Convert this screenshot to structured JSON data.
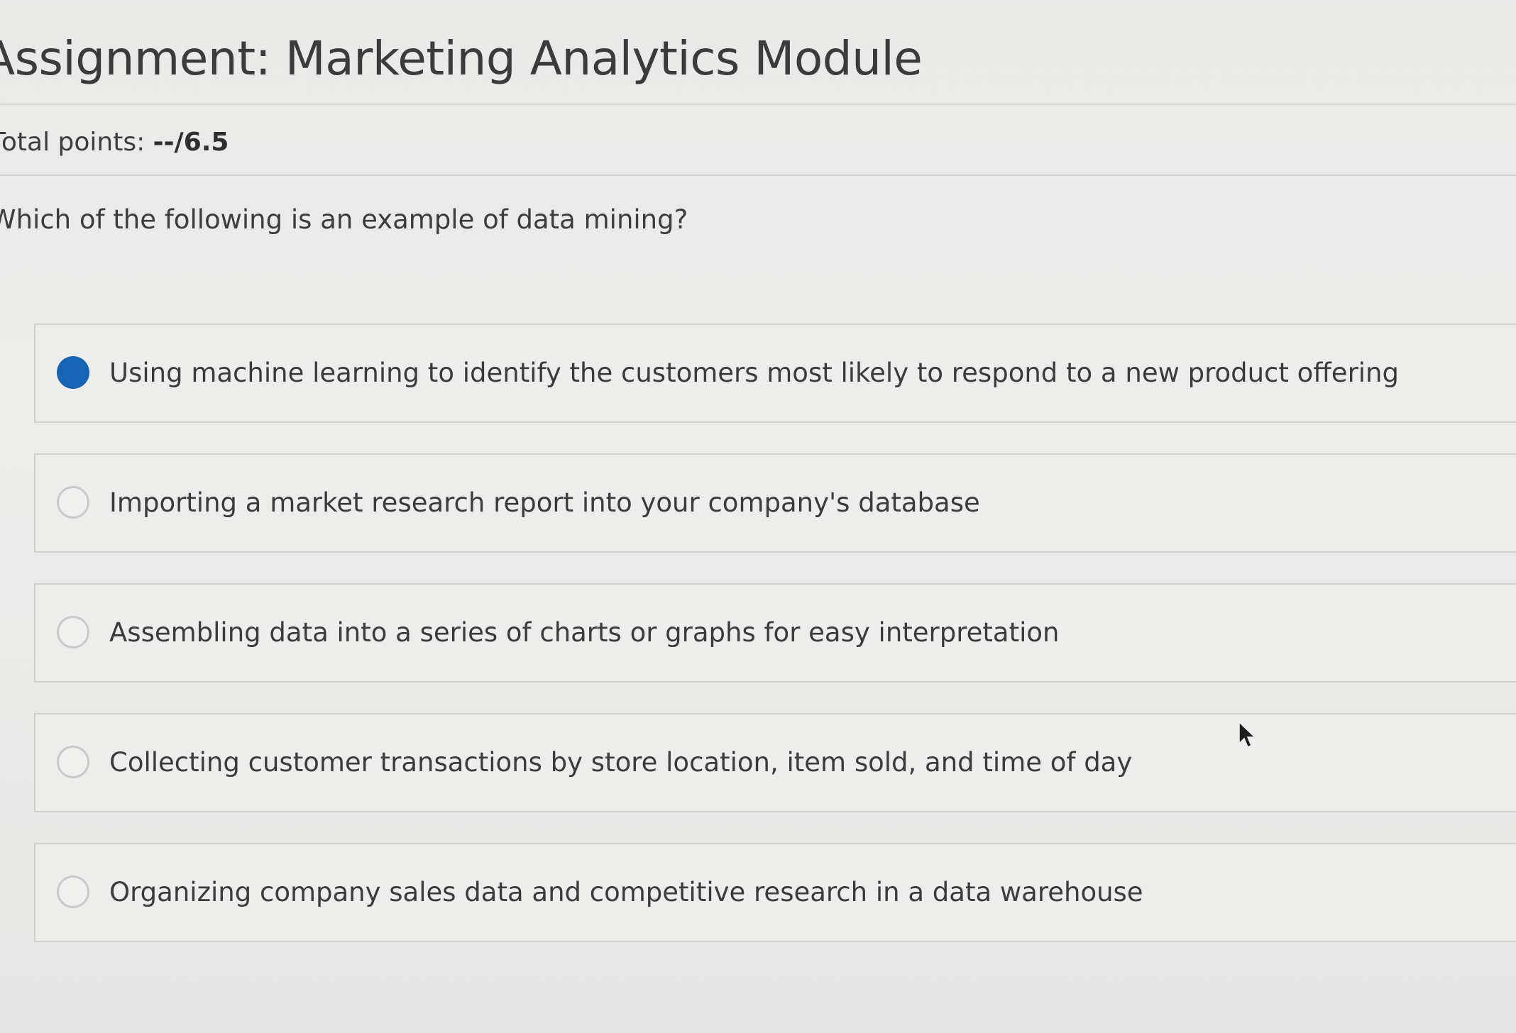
{
  "assignment": {
    "title": "Assignment: Marketing Analytics Module",
    "points_label": "Total points: ",
    "points_value": "--/6.5"
  },
  "question": {
    "text": "Which of the following is an example of data mining?",
    "options": [
      {
        "label": "Using machine learning to identify the customers most likely to respond to a new product offering",
        "selected": true
      },
      {
        "label": "Importing a market research report into your company's database",
        "selected": false
      },
      {
        "label": "Assembling data into a series of charts or graphs for easy interpretation",
        "selected": false
      },
      {
        "label": "Collecting customer transactions by store location, item sold, and time of day",
        "selected": false
      },
      {
        "label": "Organizing company sales data and competitive research in a data warehouse",
        "selected": false
      }
    ]
  },
  "colors": {
    "selected_radio": "#1763b5",
    "background": "#ebebea",
    "text": "#3b3b3b"
  },
  "icons": {
    "pointer": "mouse-pointer-icon"
  }
}
